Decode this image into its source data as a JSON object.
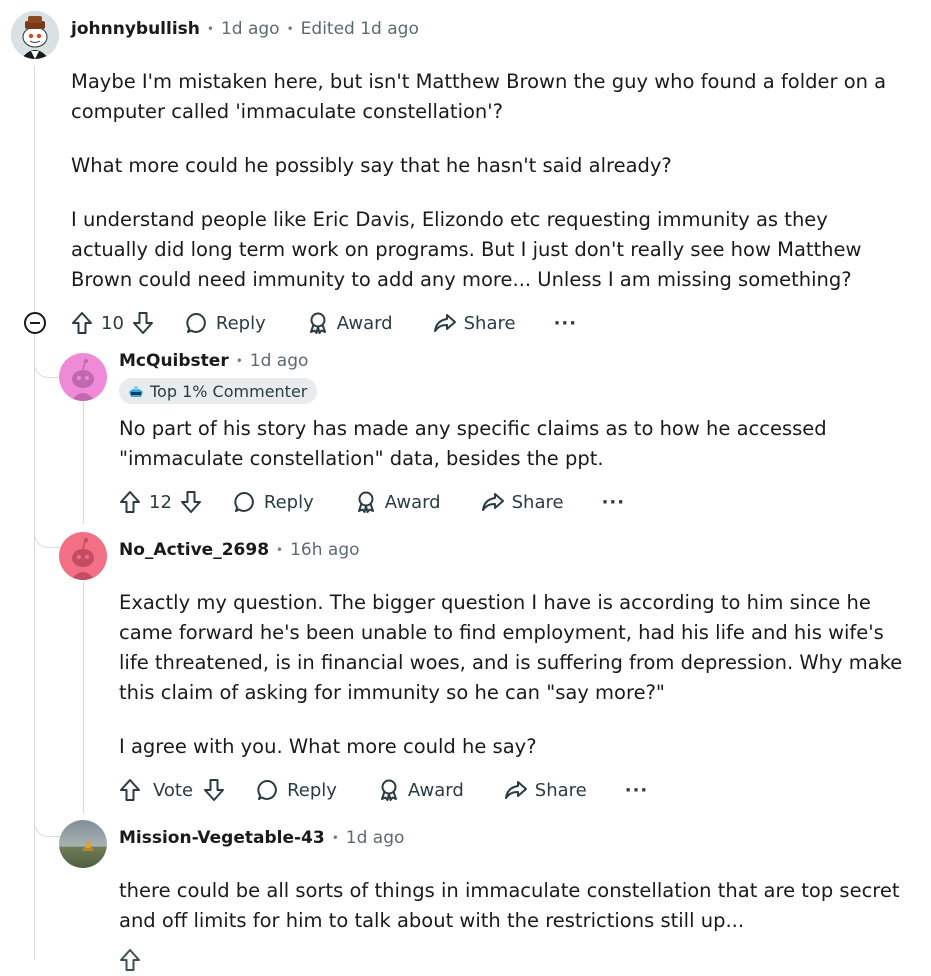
{
  "comments": [
    {
      "author": "johnnybullish",
      "time": "1d ago",
      "edited": "Edited 1d ago",
      "paragraphs": [
        "Maybe I'm mistaken here, but isn't Matthew Brown the guy who found a folder on a computer called 'immaculate constellation'?",
        "What more could he possibly say that he hasn't said already?",
        "I understand people like Eric Davis, Elizondo etc requesting immunity as they actually did long term work on programs. But I just don't really see how Matthew Brown could need immunity to add any more... Unless I am missing something?"
      ],
      "votes": "10",
      "reply": "Reply",
      "award": "Award",
      "share": "Share",
      "more": "···"
    },
    {
      "author": "McQuibster",
      "time": "1d ago",
      "flair": "Top 1% Commenter",
      "paragraphs": [
        "No part of his story has made any specific claims as to how he accessed \"immaculate constellation\" data, besides the ppt."
      ],
      "votes": "12",
      "reply": "Reply",
      "award": "Award",
      "share": "Share",
      "more": "···"
    },
    {
      "author": "No_Active_2698",
      "time": "16h ago",
      "paragraphs": [
        "Exactly my question. The bigger question I have is according to him since he came forward he's been unable to find employment, had his life and his wife's life threatened, is in financial woes, and is suffering from depression. Why make this claim of asking for immunity so he can \"say more?\"",
        "I agree with you. What more could he say?"
      ],
      "votes": "Vote",
      "reply": "Reply",
      "award": "Award",
      "share": "Share",
      "more": "···"
    },
    {
      "author": "Mission-Vegetable-43",
      "time": "1d ago",
      "paragraphs": [
        "there could be all sorts of things in immaculate constellation that are top secret and off limits for him to talk about with the restrictions still up..."
      ]
    }
  ],
  "icons": {
    "upvote": "arrow-up-icon",
    "downvote": "arrow-down-icon",
    "reply": "speech-bubble-icon",
    "award": "award-ribbon-icon",
    "share": "share-arrow-icon",
    "collapse": "minus-circle-icon"
  },
  "colors": {
    "text": "#1a1a1b",
    "meta": "#5c6a73",
    "thread_line": "#d4dbe0",
    "avatar_pink": "#ef8bd6",
    "avatar_red": "#f26f86"
  }
}
